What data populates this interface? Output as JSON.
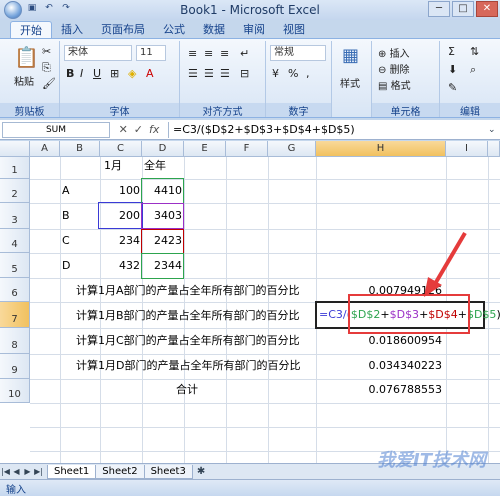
{
  "window": {
    "title": "Book1 - Microsoft Excel"
  },
  "tabs": [
    "开始",
    "插入",
    "页面布局",
    "公式",
    "数据",
    "审阅",
    "视图"
  ],
  "ribbon": {
    "paste": "粘贴",
    "clipboard": "剪贴板",
    "font_name": "宋体",
    "font_size": "11",
    "font": "字体",
    "align": "对齐方式",
    "number_format": "常规",
    "number": "数字",
    "style": "样式",
    "insert": "插入",
    "delete": "删除",
    "format": "格式",
    "cells": "单元格",
    "editing": "编辑"
  },
  "formula_bar": {
    "name_box": "SUM",
    "fx": "fx",
    "formula": "=C3/($D$2+$D$3+$D$4+$D$5)"
  },
  "columns": [
    "A",
    "B",
    "C",
    "D",
    "E",
    "F",
    "G",
    "H",
    "I"
  ],
  "rows": [
    "1",
    "2",
    "3",
    "4",
    "5",
    "6",
    "7",
    "8",
    "9",
    "10"
  ],
  "cells": {
    "C1": "1月",
    "D1": "全年",
    "B2": "A",
    "C2": "100",
    "D2": "4410",
    "B3": "B",
    "C3": "200",
    "D3": "3403",
    "B4": "C",
    "C4": "234",
    "D4": "2423",
    "B5": "D",
    "C5": "432",
    "D5": "2344",
    "B6": "计算1月A部门的产量占全年所有部门的百分比",
    "H6": "0.007949126",
    "B7": "计算1月B部门的产量占全年所有部门的百分比",
    "B8": "计算1月C部门的产量占全年所有部门的百分比",
    "H8": "0.018600954",
    "B9": "计算1月D部门的产量占全年所有部门的百分比",
    "H9": "0.034340223",
    "D10": "合计",
    "H10": "0.076788553"
  },
  "edit_formula": {
    "prefix": "=C3/(",
    "p1": "$D$2",
    "plus1": "+",
    "p2": "$D$3",
    "plus2": "+",
    "p3": "$D$4",
    "plus3": "+",
    "p4": "$D$5",
    "suffix": ")"
  },
  "sheets": [
    "Sheet1",
    "Sheet2",
    "Sheet3"
  ],
  "status": {
    "mode": "输入"
  },
  "watermark": "我爱IT技术网",
  "colors": {
    "accent": "#15428b",
    "ref_blue": "#3a3ad6",
    "ref_red": "#c00000",
    "ref_purple": "#9b30c6",
    "ref_green": "#2da44e",
    "annotation": "#e53b3b"
  }
}
